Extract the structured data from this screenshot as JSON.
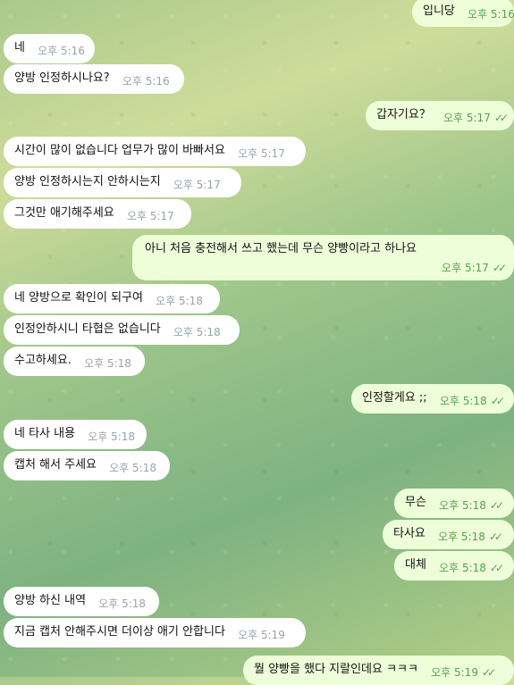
{
  "messages": [
    {
      "text": "입니당",
      "time": "오후 5:16",
      "dir": "out",
      "check": "✓✓"
    },
    {
      "text": "네",
      "time": "오후 5:16",
      "dir": "in"
    },
    {
      "text": "양방 인정하시나요?",
      "time": "오후 5:16",
      "dir": "in"
    },
    {
      "text": "갑자기요？",
      "time": "오후 5:17",
      "dir": "out",
      "check": "✓✓"
    },
    {
      "text": "시간이 많이 없습니다 업무가 많이 바빠서요",
      "time": "오후 5:17",
      "dir": "in"
    },
    {
      "text": "양방 인정하시는지 안하시는지",
      "time": "오후 5:17",
      "dir": "in"
    },
    {
      "text": "그것만 애기해주세요",
      "time": "오후 5:17",
      "dir": "in"
    },
    {
      "text": "아니 처음 충전해서 쓰고 했는데 무슨 양빵이라고 하나요",
      "time": "오후 5:17",
      "dir": "out",
      "check": "✓✓"
    },
    {
      "text": "네 양방으로 확인이 되구여",
      "time": "오후 5:18",
      "dir": "in"
    },
    {
      "text": "인정안하시니 타협은 없습니다",
      "time": "오후 5:18",
      "dir": "in"
    },
    {
      "text": "수고하세요.",
      "time": "오후 5:18",
      "dir": "in"
    },
    {
      "text": "인정할게요 ;;",
      "time": "오후 5:18",
      "dir": "out",
      "check": "✓✓"
    },
    {
      "text": "네 타사 내용",
      "time": "오후 5:18",
      "dir": "in"
    },
    {
      "text": "캡처 해서 주세요",
      "time": "오후 5:18",
      "dir": "in"
    },
    {
      "text": "무슨",
      "time": "오후 5:18",
      "dir": "out",
      "check": "✓✓"
    },
    {
      "text": "타사요",
      "time": "오후 5:18",
      "dir": "out",
      "check": "✓✓"
    },
    {
      "text": "대체",
      "time": "오후 5:18",
      "dir": "out",
      "check": "✓✓"
    },
    {
      "text": "양방 하신 내역",
      "time": "오후 5:18",
      "dir": "in"
    },
    {
      "text": "지금 캡처 안해주시면 더이상 애기 안합니다",
      "time": "오후 5:19",
      "dir": "in"
    },
    {
      "text": "뭘 양빵을 했다 지랄인데요 ㅋㅋㅋ",
      "time": "오후 5:19",
      "dir": "out",
      "check": "✓✓"
    }
  ]
}
